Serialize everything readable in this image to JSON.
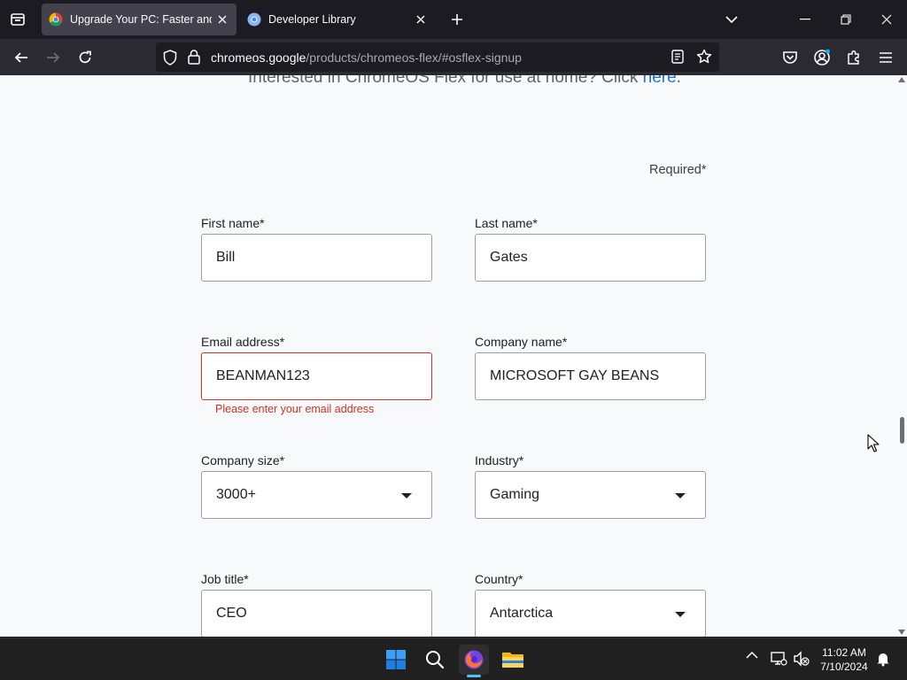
{
  "browser": {
    "tabs": [
      {
        "title": "Upgrade Your PC: Faster and More Secure",
        "active": true
      },
      {
        "title": "Developer Library",
        "active": false
      }
    ],
    "url": {
      "domain": "chromeos.google",
      "path": "/products/chromeos-flex/#osflex-signup"
    }
  },
  "page": {
    "top_line": {
      "text": "Interested in ChromeOS Flex for use at home? Click ",
      "link": "here",
      "tail": "."
    },
    "required_note": "Required*",
    "form": {
      "first_name": {
        "label": "First name*",
        "value": "Bill"
      },
      "last_name": {
        "label": "Last name*",
        "value": "Gates"
      },
      "email": {
        "label": "Email address*",
        "value": "BEANMAN123",
        "error": "Please enter your email address"
      },
      "company_name": {
        "label": "Company name*",
        "value": "MICROSOFT GAY BEANS"
      },
      "company_size": {
        "label": "Company size*",
        "value": "3000+"
      },
      "industry": {
        "label": "Industry*",
        "value": "Gaming"
      },
      "job_title": {
        "label": "Job title*",
        "value": "CEO"
      },
      "country": {
        "label": "Country*",
        "value": "Antarctica"
      }
    }
  },
  "taskbar": {
    "time": "11:02 AM",
    "date": "7/10/2024",
    "icons": [
      "windows-start-icon",
      "search-icon",
      "firefox-icon",
      "file-explorer-icon"
    ]
  },
  "colors": {
    "accent": "#1a73e8",
    "error": "#d93025",
    "browser_chrome": "#2b2a33",
    "taskbar": "#202020"
  }
}
